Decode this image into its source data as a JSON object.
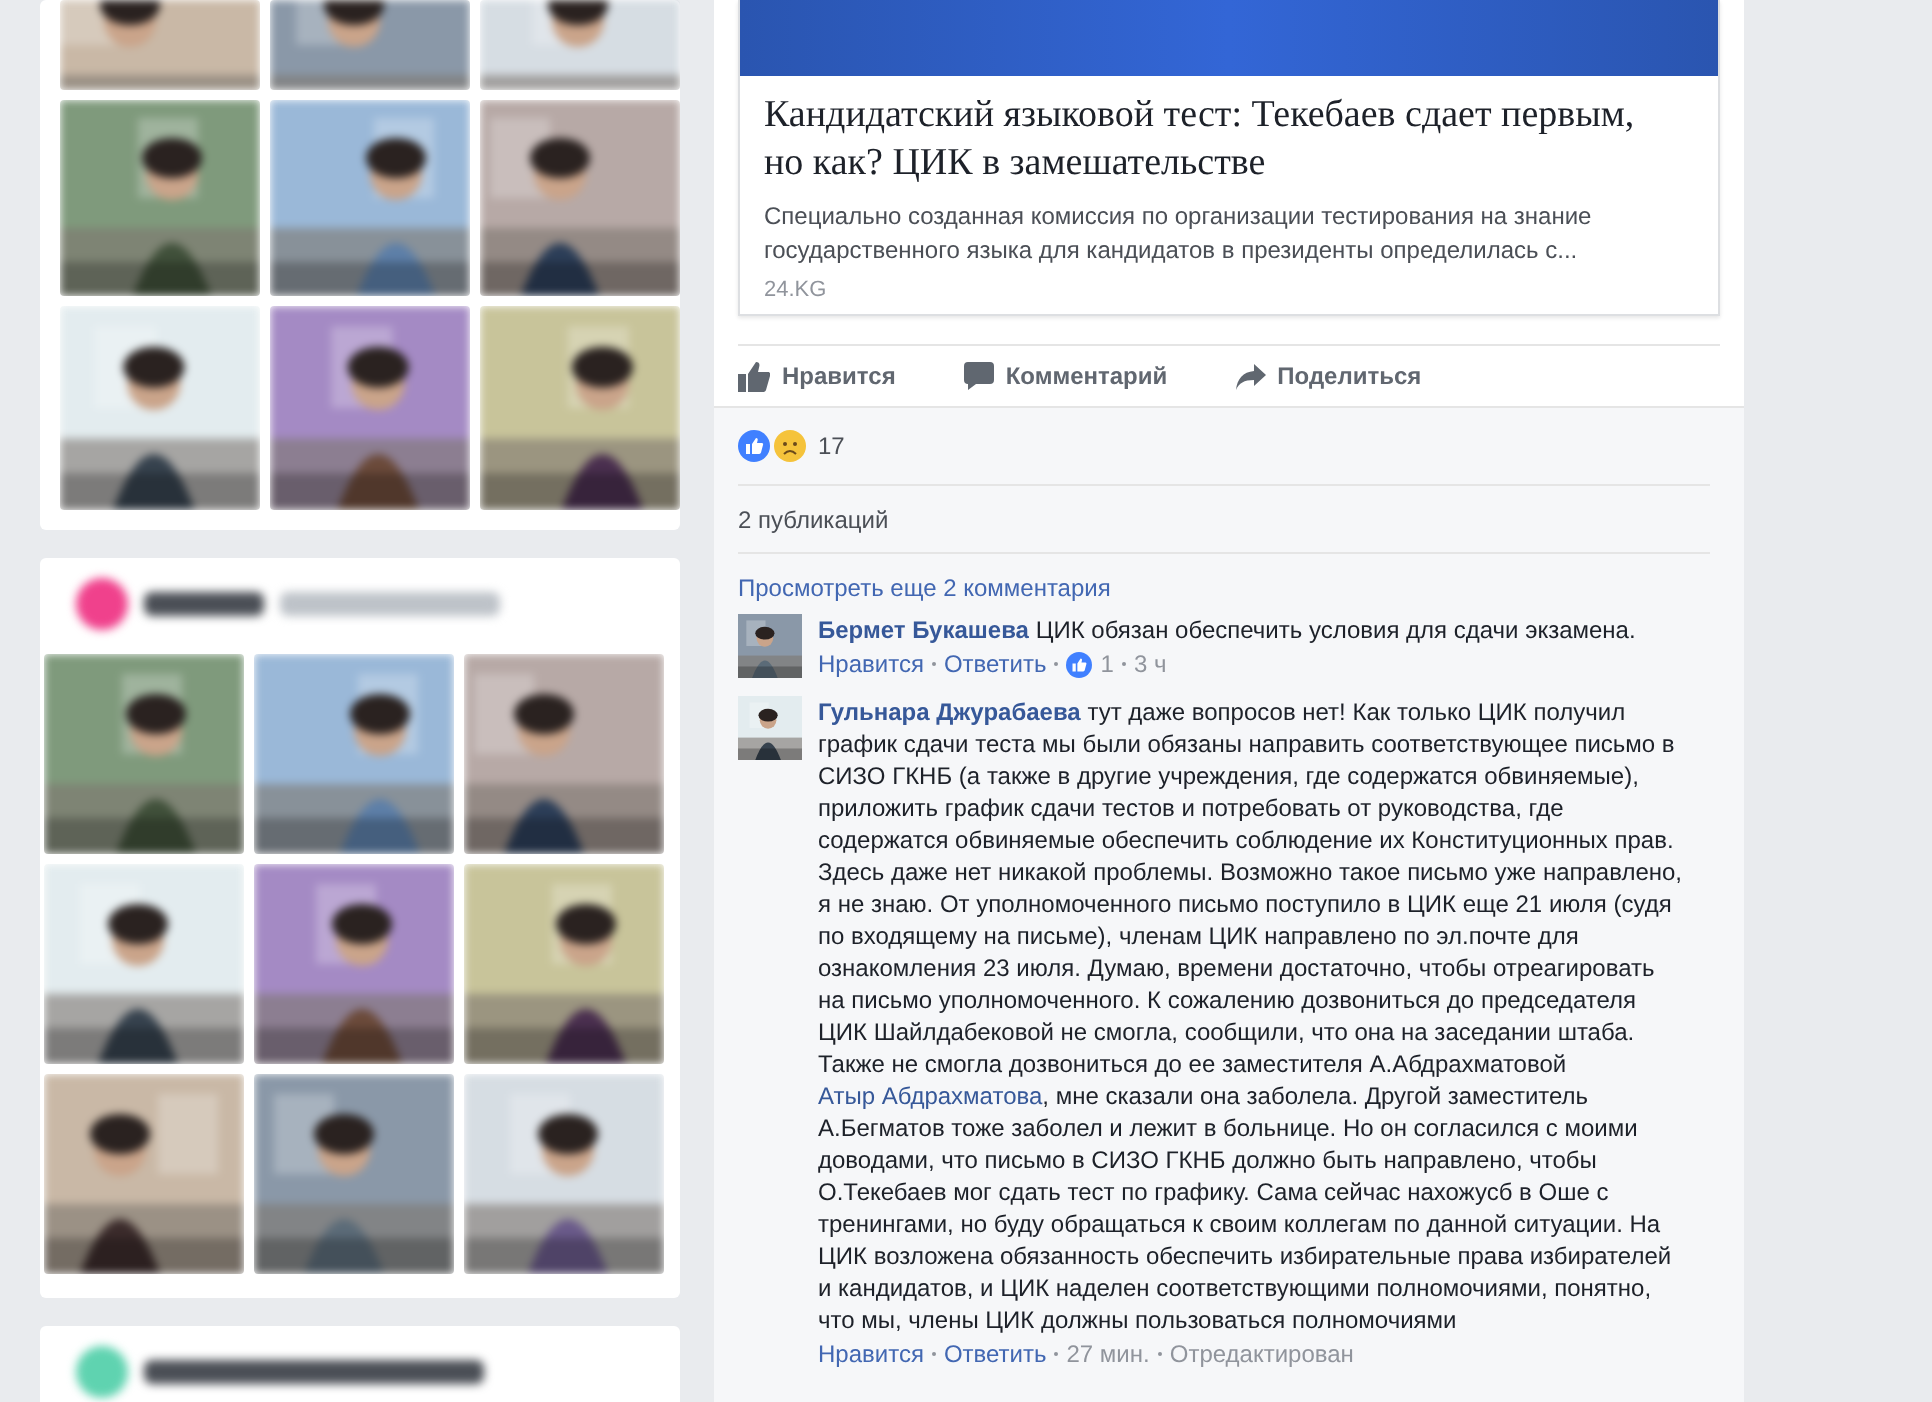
{
  "sidebar": {
    "friends": {
      "color": "#f0418c"
    },
    "albums": {
      "color": "#5fd3b0"
    }
  },
  "post": {
    "link": {
      "title": "Кандидатский языковой тест: Текебаев сдает первым, но как? ЦИК в замешательстве",
      "description": "Специально созданная комиссия по организации тестирования на знание государственного языка для кандидатов в президенты определилась с...",
      "source": "24.KG"
    },
    "actions": [
      {
        "kind": "like",
        "label": "Нравится"
      },
      {
        "kind": "comment",
        "label": "Комментарий"
      },
      {
        "kind": "share",
        "label": "Поделиться"
      }
    ],
    "reactions": {
      "count": "17"
    },
    "shares": "2 публикаций",
    "more_comments": "Просмотреть еще 2 комментария",
    "comments": [
      {
        "author": "Бермет Букашева",
        "text": "ЦИК обязан обеспечить условия для сдачи экзамена.",
        "like": "Нравится",
        "reply": "Ответить",
        "likes": "1",
        "time": "3 ч"
      },
      {
        "author": "Гульнара Джурабаева",
        "text": "тут даже вопросов нет! Как только ЦИК получил график сдачи теста мы были обязаны направить соответствующее письмо в СИЗО ГКНБ (а также в другие учреждения, где содержатся обвиняемые), приложить график сдачи тестов и потребовать от руководства, где содержатся обвиняемые обеспечить соблюдение их Конституционных прав. Здесь даже нет никакой проблемы. Возможно такое письмо уже направлено, я не знаю. От уполномоченного письмо поступило в ЦИК еще 21 июля (судя по входящему на письме), членам ЦИК направлено по эл.почте для ознакомления 23 июля. Думаю, времени достаточно, чтобы отреагировать на письмо уполномоченного. К сожалению дозвониться до председателя ЦИК Шайлдабековой не смогла, сообщили, что она на заседании штаба. Также не смогла дозвониться до ее заместителя А.Абдрахматовой",
        "mention": "Атыр Абдрахматова",
        "text_after": ", мне сказали она заболела. Другой заместитель А.Бегматов тоже заболел и лежит в больнице. Но он согласился с моими доводами, что письмо в СИЗО ГКНБ должно быть направлено, чтобы О.Текебаев мог сдать тест по графику. Сама сейчас нахожусб в Оше с тренингами, но буду обращаться к своим коллегам по данной ситуации. На ЦИК возложена обязанность обеспечить избирательные права избирателей и кандидатов, и ЦИК наделен соответствующими полномочиями, понятно, что мы, члены ЦИК должны пользоваться полномочиями",
        "like": "Нравится",
        "reply": "Ответить",
        "time": "27 мин.",
        "edited": "Отредактирован"
      }
    ]
  }
}
